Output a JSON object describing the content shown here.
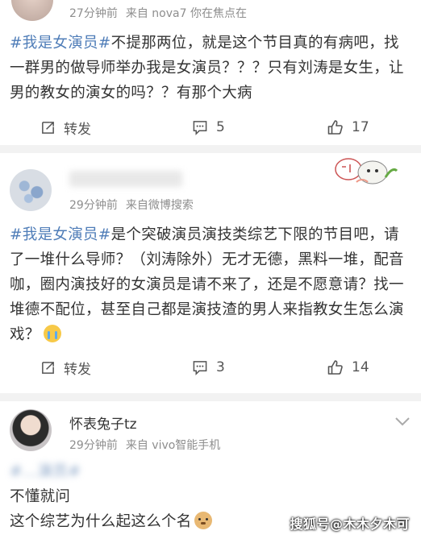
{
  "post1": {
    "meta_time": "27分钟前",
    "meta_source": "来自 nova7 你在焦点在",
    "topic": "#我是女演员#",
    "content": "不提那两位，就是这个节目真的有病吧，找一群男的做导师举办我是女演员？？？只有刘涛是女生，让男的教女的演女的吗？？有那个大病",
    "repost_label": "转发",
    "comment_count": "5",
    "like_count": "17"
  },
  "post2": {
    "username": "",
    "meta_time": "29分钟前",
    "meta_source": "来自微博搜索",
    "topic": "#我是女演员#",
    "content": "是个突破演员演技类综艺下限的节目吧，请了一堆什么导师？（刘涛除外）无才无德，黑料一堆，配音咖，圈内演技好的女演员是请不来了，还是不愿意请？找一堆德不配位，甚至自己都是演技渣的男人来指教女生怎么演戏？",
    "repost_label": "转发",
    "comment_count": "3",
    "like_count": "14"
  },
  "post3": {
    "username": "怀表兔子tz",
    "meta_time": "29分钟前",
    "meta_source": "来自 vivo智能手机",
    "blurred_topic": "#…演员#",
    "line1": "不懂就问",
    "line2": "这个综艺为什么起这么个名"
  },
  "watermark": "搜狐号@木木夕木可",
  "colors": {
    "topic": "#4f7db8",
    "text": "#333333",
    "meta": "#8e8e8e",
    "separator": "#f2f2f2"
  },
  "icons": [
    "repost-icon",
    "comment-icon",
    "like-icon",
    "chevron-down-icon"
  ]
}
